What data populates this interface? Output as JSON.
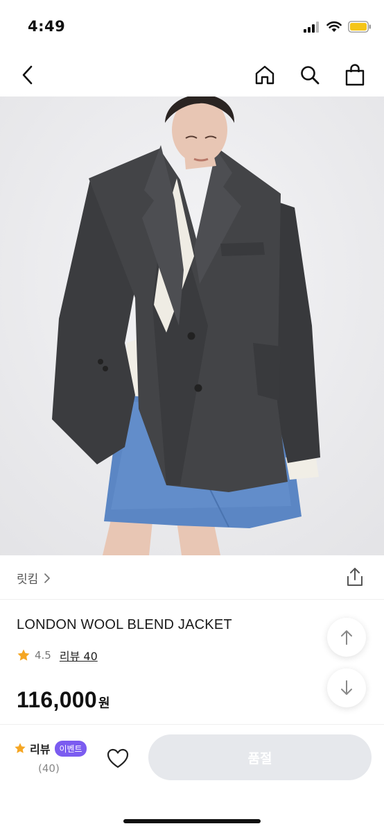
{
  "status_bar": {
    "time": "4:49"
  },
  "nav": {
    "back_icon": "chevron-left-icon",
    "home_icon": "home-icon",
    "search_icon": "search-icon",
    "cart_icon": "shopping-bag-icon"
  },
  "product": {
    "brand": "릿킴",
    "name": "LONDON WOOL BLEND JACKET",
    "rating": "4.5",
    "review_link": "리뷰 40",
    "price": "116,000",
    "currency": "원"
  },
  "bottom": {
    "review_label": "리뷰",
    "event_badge": "이벤트",
    "review_count": "(40)",
    "soldout_label": "품절"
  },
  "colors": {
    "accent_purple": "#7b5cf0",
    "star": "#f5a623",
    "disabled_button": "#e6e8ec",
    "battery": "#f5c518"
  }
}
